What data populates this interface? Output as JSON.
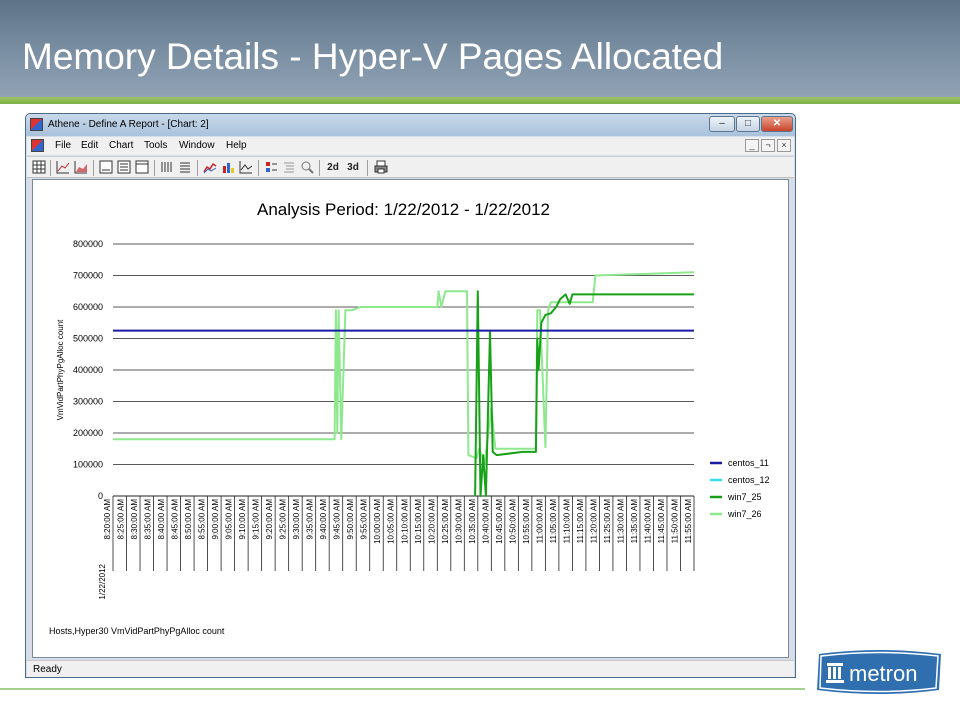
{
  "slide": {
    "title": "Memory Details - Hyper-V Pages Allocated"
  },
  "window": {
    "title": "Athene - Define A Report - [Chart: 2]",
    "controls": {
      "minimize": "–",
      "maximize": "□",
      "close": "✕"
    },
    "mdi_controls": {
      "minimize": "_",
      "restore": "¬",
      "close": "×"
    }
  },
  "menu": {
    "items": [
      "File",
      "Edit",
      "Chart",
      "Tools",
      "Window",
      "Help"
    ]
  },
  "toolbar": {
    "label_2d": "2d",
    "label_3d": "3d"
  },
  "status": {
    "text": "Ready"
  },
  "logo": {
    "text": "metron"
  },
  "colors": {
    "centos_11": "#1a1aa6",
    "centos_12": "#33e0f0",
    "win7_25": "#17a117",
    "win7_26": "#8ee88e"
  },
  "chart_data": {
    "type": "line",
    "title": "Analysis Period: 1/22/2012 - 1/22/2012",
    "ylabel": "VmVidPartPhyPgAlloc count",
    "xlabel": "",
    "date_label": "1/22/2012",
    "footnote": "Hosts,Hyper30 VmVidPartPhyPgAlloc count",
    "ylim": [
      0,
      800000
    ],
    "y_ticks": [
      "0",
      "100000",
      "200000",
      "300000",
      "400000",
      "500000",
      "600000",
      "700000",
      "800000"
    ],
    "categories": [
      "8:20:00 AM",
      "8:25:00 AM",
      "8:30:00 AM",
      "8:35:00 AM",
      "8:40:00 AM",
      "8:45:00 AM",
      "8:50:00 AM",
      "8:55:00 AM",
      "9:00:00 AM",
      "9:05:00 AM",
      "9:10:00 AM",
      "9:15:00 AM",
      "9:20:00 AM",
      "9:25:00 AM",
      "9:30:00 AM",
      "9:35:00 AM",
      "9:40:00 AM",
      "9:45:00 AM",
      "9:50:00 AM",
      "9:55:00 AM",
      "10:00:00 AM",
      "10:05:00 AM",
      "10:10:00 AM",
      "10:15:00 AM",
      "10:20:00 AM",
      "10:25:00 AM",
      "10:30:00 AM",
      "10:35:00 AM",
      "10:40:00 AM",
      "10:45:00 AM",
      "10:50:00 AM",
      "10:55:00 AM",
      "11:00:00 AM",
      "11:05:00 AM",
      "11:10:00 AM",
      "11:15:00 AM",
      "11:20:00 AM",
      "11:25:00 AM",
      "11:30:00 AM",
      "11:35:00 AM",
      "11:40:00 AM",
      "11:45:00 AM",
      "11:50:00 AM",
      "11:55:00 AM"
    ],
    "grid": true,
    "legend_position": "right",
    "series": [
      {
        "name": "centos_11",
        "points": [
          [
            0,
            525000
          ],
          [
            43,
            525000
          ]
        ]
      },
      {
        "name": "centos_12",
        "points": []
      },
      {
        "name": "win7_25",
        "points": [
          [
            26.8,
            0
          ],
          [
            27.0,
            650000
          ],
          [
            27.2,
            0
          ],
          [
            27.4,
            130000
          ],
          [
            27.6,
            0
          ],
          [
            27.9,
            520000
          ],
          [
            28.1,
            140000
          ],
          [
            28.4,
            130000
          ],
          [
            30.3,
            140000
          ],
          [
            31.3,
            140000
          ],
          [
            31.4,
            500000
          ],
          [
            31.5,
            400000
          ],
          [
            31.7,
            550000
          ],
          [
            32.0,
            575000
          ],
          [
            32.4,
            580000
          ],
          [
            32.8,
            600000
          ],
          [
            33.1,
            625000
          ],
          [
            33.5,
            640000
          ],
          [
            33.8,
            610000
          ],
          [
            34.0,
            640000
          ],
          [
            43,
            640000
          ]
        ]
      },
      {
        "name": "win7_26",
        "points": [
          [
            0,
            180000
          ],
          [
            16.4,
            180000
          ],
          [
            16.5,
            590000
          ],
          [
            16.6,
            200000
          ],
          [
            16.7,
            590000
          ],
          [
            16.9,
            180000
          ],
          [
            17.2,
            590000
          ],
          [
            17.7,
            590000
          ],
          [
            18.3,
            600000
          ],
          [
            24.0,
            600000
          ],
          [
            24.1,
            650000
          ],
          [
            24.3,
            600000
          ],
          [
            24.6,
            650000
          ],
          [
            26.0,
            650000
          ],
          [
            26.2,
            650000
          ],
          [
            26.3,
            130000
          ],
          [
            26.9,
            120000
          ],
          [
            27.1,
            150000
          ],
          [
            27.5,
            100000
          ],
          [
            28.0,
            280000
          ],
          [
            28.3,
            150000
          ],
          [
            30.4,
            150000
          ],
          [
            30.9,
            150000
          ],
          [
            31.3,
            150000
          ],
          [
            31.4,
            590000
          ],
          [
            31.6,
            590000
          ],
          [
            32.0,
            155000
          ],
          [
            32.2,
            590000
          ],
          [
            32.4,
            615000
          ],
          [
            33.0,
            615000
          ],
          [
            34.1,
            615000
          ],
          [
            35.5,
            615000
          ],
          [
            35.7,
            700000
          ],
          [
            43,
            710000
          ]
        ]
      }
    ]
  }
}
